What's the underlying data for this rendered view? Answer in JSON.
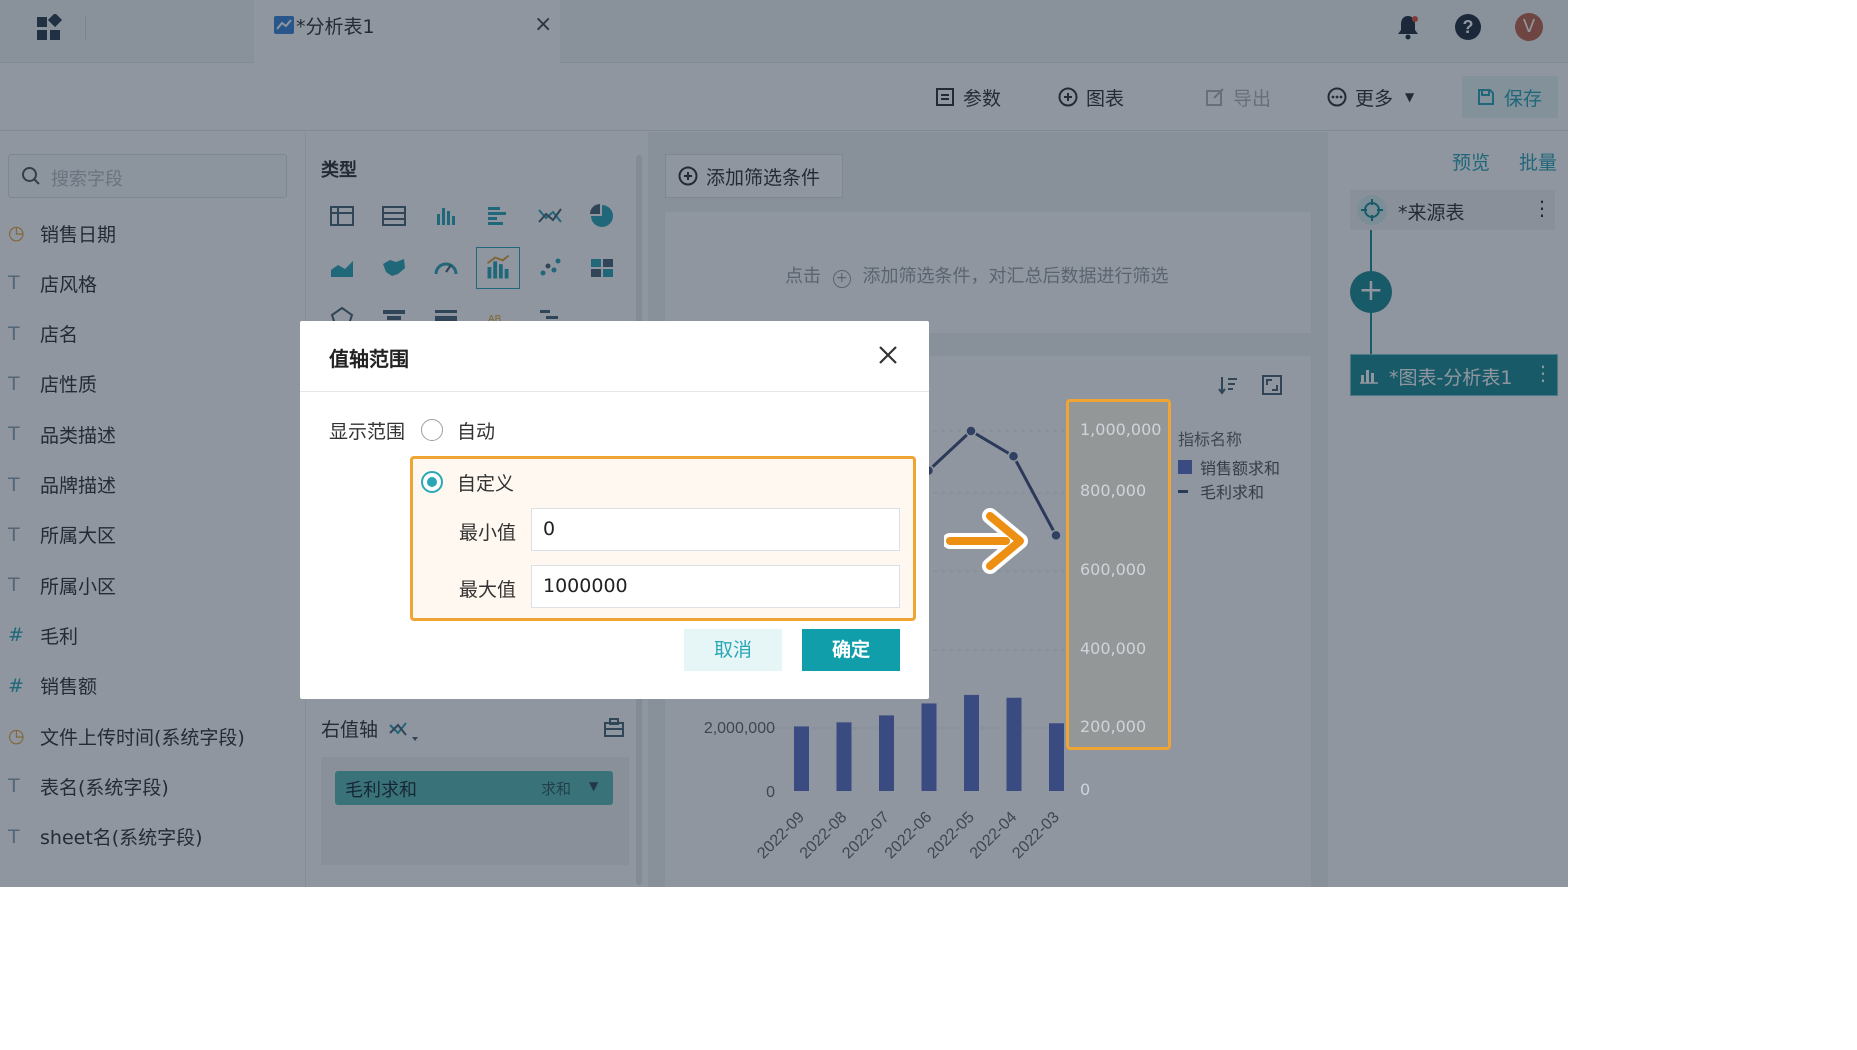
{
  "topbar": {
    "tab_label": "*分析表1",
    "tab_close": "×",
    "avatar_initial": "V"
  },
  "toolbar": {
    "params": "参数",
    "chart": "图表",
    "export": "导出",
    "more": "更多",
    "save": "保存"
  },
  "left_panel": {
    "search_placeholder": "搜索字段",
    "fields": [
      {
        "icon": "date-icon",
        "label": "销售日期"
      },
      {
        "icon": "text-icon",
        "label": "店风格"
      },
      {
        "icon": "text-icon",
        "label": "店名"
      },
      {
        "icon": "text-icon",
        "label": "店性质"
      },
      {
        "icon": "text-icon",
        "label": "品类描述"
      },
      {
        "icon": "text-icon",
        "label": "品牌描述"
      },
      {
        "icon": "text-icon",
        "label": "所属大区"
      },
      {
        "icon": "text-icon",
        "label": "所属小区"
      },
      {
        "icon": "number-icon",
        "label": "毛利"
      },
      {
        "icon": "number-icon",
        "label": "销售额"
      },
      {
        "icon": "date-icon",
        "label": "文件上传时间(系统字段)"
      },
      {
        "icon": "text-icon",
        "label": "表名(系统字段)"
      },
      {
        "icon": "text-icon",
        "label": "sheet名(系统字段)"
      }
    ]
  },
  "mid_panel": {
    "title": "类型",
    "right_axis_label": "右值轴",
    "axis_field": "毛利求和",
    "axis_agg": "求和"
  },
  "canvas": {
    "filter_button": "添加筛选条件",
    "filter_hint_pre": "点击",
    "filter_hint_post": "添加筛选条件，对汇总后数据进行筛选",
    "legend_title": "指标名称",
    "legend_series_1": "销售额求和",
    "legend_series_2": "毛利求和"
  },
  "right_panel": {
    "preview": "预览",
    "batch": "批量",
    "source_node": "*来源表",
    "chart_node": "*图表-分析表1"
  },
  "dialog": {
    "title": "值轴范围",
    "range_label": "显示范围",
    "auto_label": "自动",
    "custom_label": "自定义",
    "min_label": "最小值",
    "min_value": "0",
    "max_label": "最大值",
    "max_value": "1000000",
    "cancel": "取消",
    "ok": "确定"
  },
  "colors": {
    "accent": "#119eab",
    "highlight": "#f0a433",
    "bar": "#5b6fc4",
    "line": "#41507c"
  },
  "chart_data": {
    "type": "bar",
    "categories": [
      "2022-09",
      "2022-08",
      "2022-07",
      "2022-06",
      "2022-05",
      "2022-04",
      "2022-03"
    ],
    "left_axis_ticks": [
      "2,000,000",
      "0"
    ],
    "right_axis_ticks": [
      "1,000,000",
      "800,000",
      "600,000",
      "400,000",
      "200,000",
      "0"
    ],
    "ylim_right": [
      0,
      1000000
    ],
    "series": [
      {
        "name": "销售额求和",
        "type": "bar",
        "values": [
          2050000,
          2180000,
          2400000,
          2780000,
          3050000,
          2960000,
          2150000
        ]
      },
      {
        "name": "毛利求和",
        "type": "line",
        "values": [
          null,
          null,
          null,
          890000,
          1000000,
          930000,
          710000
        ]
      }
    ]
  }
}
